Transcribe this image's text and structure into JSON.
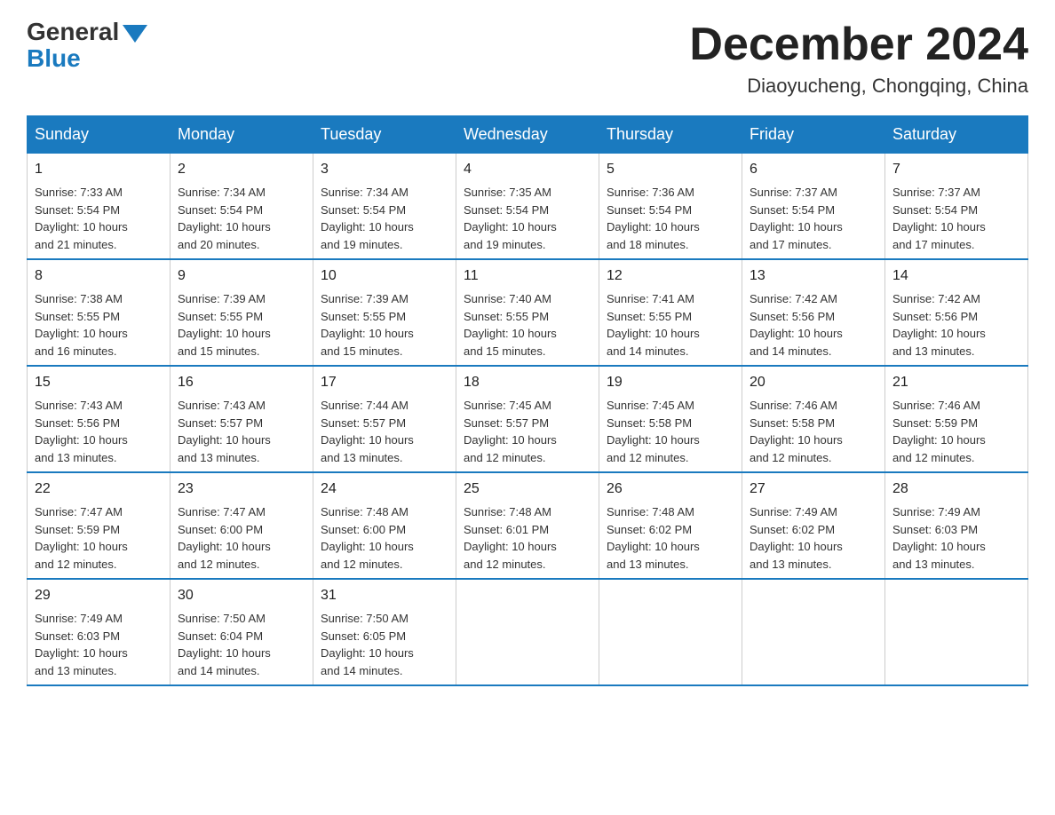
{
  "logo": {
    "general": "General",
    "blue": "Blue"
  },
  "title": "December 2024",
  "location": "Diaoyucheng, Chongqing, China",
  "days_of_week": [
    "Sunday",
    "Monday",
    "Tuesday",
    "Wednesday",
    "Thursday",
    "Friday",
    "Saturday"
  ],
  "weeks": [
    [
      {
        "day": "1",
        "sunrise": "7:33 AM",
        "sunset": "5:54 PM",
        "daylight": "10 hours and 21 minutes."
      },
      {
        "day": "2",
        "sunrise": "7:34 AM",
        "sunset": "5:54 PM",
        "daylight": "10 hours and 20 minutes."
      },
      {
        "day": "3",
        "sunrise": "7:34 AM",
        "sunset": "5:54 PM",
        "daylight": "10 hours and 19 minutes."
      },
      {
        "day": "4",
        "sunrise": "7:35 AM",
        "sunset": "5:54 PM",
        "daylight": "10 hours and 19 minutes."
      },
      {
        "day": "5",
        "sunrise": "7:36 AM",
        "sunset": "5:54 PM",
        "daylight": "10 hours and 18 minutes."
      },
      {
        "day": "6",
        "sunrise": "7:37 AM",
        "sunset": "5:54 PM",
        "daylight": "10 hours and 17 minutes."
      },
      {
        "day": "7",
        "sunrise": "7:37 AM",
        "sunset": "5:54 PM",
        "daylight": "10 hours and 17 minutes."
      }
    ],
    [
      {
        "day": "8",
        "sunrise": "7:38 AM",
        "sunset": "5:55 PM",
        "daylight": "10 hours and 16 minutes."
      },
      {
        "day": "9",
        "sunrise": "7:39 AM",
        "sunset": "5:55 PM",
        "daylight": "10 hours and 15 minutes."
      },
      {
        "day": "10",
        "sunrise": "7:39 AM",
        "sunset": "5:55 PM",
        "daylight": "10 hours and 15 minutes."
      },
      {
        "day": "11",
        "sunrise": "7:40 AM",
        "sunset": "5:55 PM",
        "daylight": "10 hours and 15 minutes."
      },
      {
        "day": "12",
        "sunrise": "7:41 AM",
        "sunset": "5:55 PM",
        "daylight": "10 hours and 14 minutes."
      },
      {
        "day": "13",
        "sunrise": "7:42 AM",
        "sunset": "5:56 PM",
        "daylight": "10 hours and 14 minutes."
      },
      {
        "day": "14",
        "sunrise": "7:42 AM",
        "sunset": "5:56 PM",
        "daylight": "10 hours and 13 minutes."
      }
    ],
    [
      {
        "day": "15",
        "sunrise": "7:43 AM",
        "sunset": "5:56 PM",
        "daylight": "10 hours and 13 minutes."
      },
      {
        "day": "16",
        "sunrise": "7:43 AM",
        "sunset": "5:57 PM",
        "daylight": "10 hours and 13 minutes."
      },
      {
        "day": "17",
        "sunrise": "7:44 AM",
        "sunset": "5:57 PM",
        "daylight": "10 hours and 13 minutes."
      },
      {
        "day": "18",
        "sunrise": "7:45 AM",
        "sunset": "5:57 PM",
        "daylight": "10 hours and 12 minutes."
      },
      {
        "day": "19",
        "sunrise": "7:45 AM",
        "sunset": "5:58 PM",
        "daylight": "10 hours and 12 minutes."
      },
      {
        "day": "20",
        "sunrise": "7:46 AM",
        "sunset": "5:58 PM",
        "daylight": "10 hours and 12 minutes."
      },
      {
        "day": "21",
        "sunrise": "7:46 AM",
        "sunset": "5:59 PM",
        "daylight": "10 hours and 12 minutes."
      }
    ],
    [
      {
        "day": "22",
        "sunrise": "7:47 AM",
        "sunset": "5:59 PM",
        "daylight": "10 hours and 12 minutes."
      },
      {
        "day": "23",
        "sunrise": "7:47 AM",
        "sunset": "6:00 PM",
        "daylight": "10 hours and 12 minutes."
      },
      {
        "day": "24",
        "sunrise": "7:48 AM",
        "sunset": "6:00 PM",
        "daylight": "10 hours and 12 minutes."
      },
      {
        "day": "25",
        "sunrise": "7:48 AM",
        "sunset": "6:01 PM",
        "daylight": "10 hours and 12 minutes."
      },
      {
        "day": "26",
        "sunrise": "7:48 AM",
        "sunset": "6:02 PM",
        "daylight": "10 hours and 13 minutes."
      },
      {
        "day": "27",
        "sunrise": "7:49 AM",
        "sunset": "6:02 PM",
        "daylight": "10 hours and 13 minutes."
      },
      {
        "day": "28",
        "sunrise": "7:49 AM",
        "sunset": "6:03 PM",
        "daylight": "10 hours and 13 minutes."
      }
    ],
    [
      {
        "day": "29",
        "sunrise": "7:49 AM",
        "sunset": "6:03 PM",
        "daylight": "10 hours and 13 minutes."
      },
      {
        "day": "30",
        "sunrise": "7:50 AM",
        "sunset": "6:04 PM",
        "daylight": "10 hours and 14 minutes."
      },
      {
        "day": "31",
        "sunrise": "7:50 AM",
        "sunset": "6:05 PM",
        "daylight": "10 hours and 14 minutes."
      },
      null,
      null,
      null,
      null
    ]
  ],
  "labels": {
    "sunrise": "Sunrise:",
    "sunset": "Sunset:",
    "daylight": "Daylight:"
  }
}
